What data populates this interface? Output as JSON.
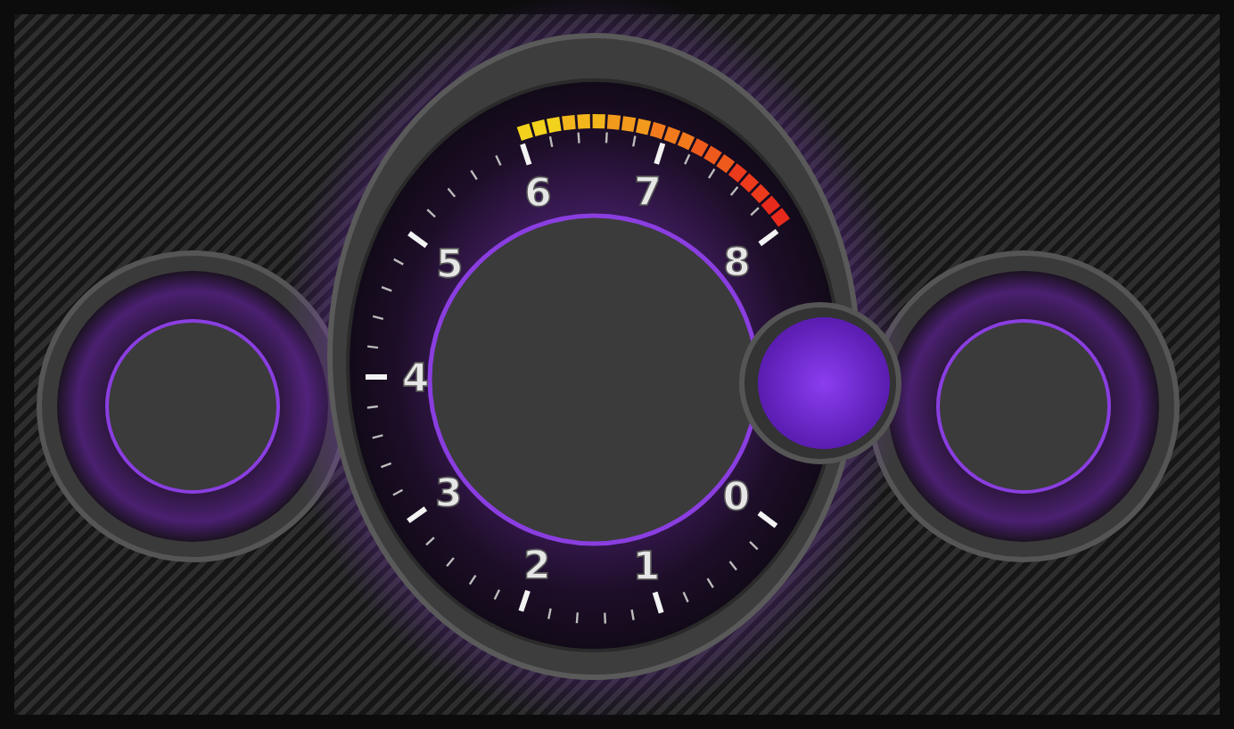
{
  "tachometer": {
    "scale": [
      {
        "label": "0"
      },
      {
        "label": "1"
      },
      {
        "label": "2"
      },
      {
        "label": "3"
      },
      {
        "label": "4"
      },
      {
        "label": "5"
      },
      {
        "label": "6"
      },
      {
        "label": "7"
      },
      {
        "label": "8"
      }
    ]
  }
}
